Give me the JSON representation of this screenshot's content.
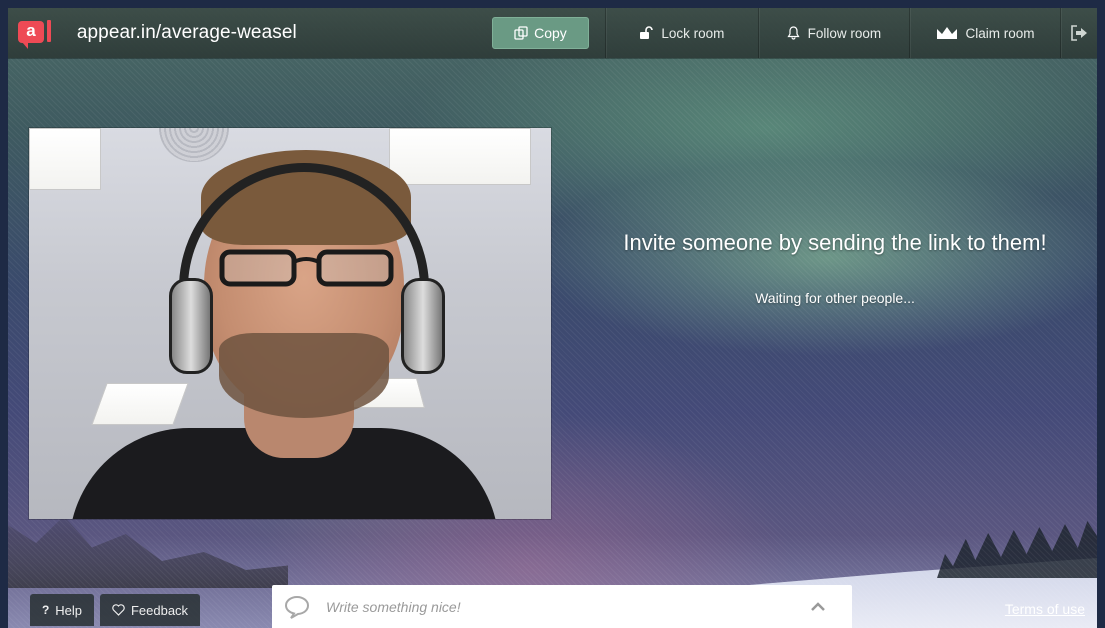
{
  "header": {
    "logo_letter": "a",
    "room_url": "appear.in/average-weasel",
    "copy_label": "Copy",
    "lock_label": "Lock room",
    "follow_label": "Follow room",
    "claim_label": "Claim room"
  },
  "main": {
    "invite_text": "Invite someone by sending the link to them!",
    "waiting_text": "Waiting for other people..."
  },
  "footer": {
    "help_label": "Help",
    "help_icon_glyph": "?",
    "feedback_label": "Feedback",
    "chat_placeholder": "Write something nice!",
    "terms_label": "Terms of use"
  },
  "icons": {
    "copy": "copy-icon",
    "lock": "unlock-icon",
    "follow": "bell-icon",
    "claim": "crown-icon",
    "leave": "leave-room-icon",
    "feedback": "heart-icon",
    "chat": "speech-bubble-icon",
    "expand": "chevron-up-icon"
  },
  "colors": {
    "brand": "#ee4a55",
    "copy_button": "#6a9a84"
  }
}
